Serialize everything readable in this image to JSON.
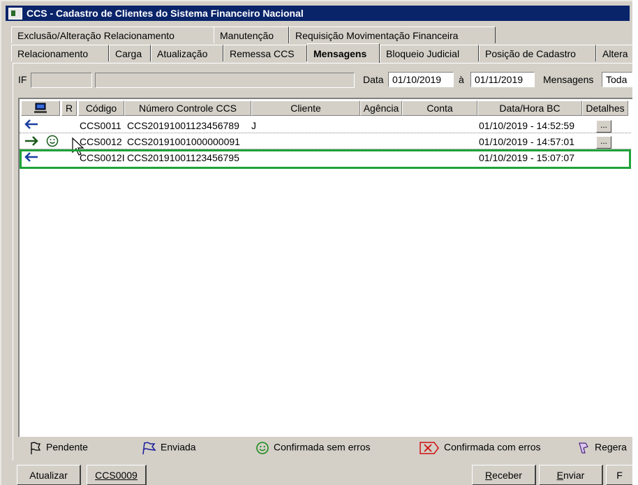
{
  "window": {
    "title": "CCS - Cadastro de Clientes do Sistema Financeiro Nacional"
  },
  "tabs_row1": [
    {
      "label": "Exclusão/Alteração Relacionamento"
    },
    {
      "label": "Manutenção"
    },
    {
      "label": "Requisição Movimentação Financeira"
    }
  ],
  "tabs_row2": [
    {
      "label": "Relacionamento"
    },
    {
      "label": "Carga"
    },
    {
      "label": "Atualização"
    },
    {
      "label": "Remessa CCS"
    },
    {
      "label": "Mensagens",
      "active": true
    },
    {
      "label": "Bloqueio Judicial"
    },
    {
      "label": "Posição de Cadastro"
    },
    {
      "label": "Altera"
    }
  ],
  "filters": {
    "if_label": "IF",
    "if_code": "",
    "if_name": "",
    "data_label": "Data",
    "date_from": "01/10/2019",
    "a_label": "à",
    "date_to": "01/11/2019",
    "mensagens_label": "Mensagens",
    "mensagens_value": "Toda"
  },
  "grid": {
    "columns": [
      "R",
      "Código",
      "Número Controle CCS",
      "Cliente",
      "Agência",
      "Conta",
      "Data/Hora BC",
      "Detalhes"
    ],
    "rows": [
      {
        "direction": "in",
        "status": "",
        "codigo": "CCS0011",
        "numero": "CCS20191001123456789",
        "cliente": "J",
        "agencia": "",
        "conta": "",
        "datahora": "01/10/2019 - 14:52:59",
        "details": "..."
      },
      {
        "direction": "out",
        "status": "confirmed",
        "codigo": "CCS0012",
        "numero": "CCS20191001000000091",
        "cliente": "",
        "agencia": "",
        "conta": "",
        "datahora": "01/10/2019 - 14:57:01",
        "details": "..."
      },
      {
        "direction": "in",
        "status": "",
        "codigo": "CCS0012I",
        "numero": "CCS20191001123456795",
        "cliente": "",
        "agencia": "",
        "conta": "",
        "datahora": "01/10/2019 - 15:07:07",
        "details": ""
      }
    ]
  },
  "legend": [
    {
      "icon": "flag-outline-icon",
      "label": "Pendente"
    },
    {
      "icon": "flag-blue-icon",
      "label": "Enviada"
    },
    {
      "icon": "smiley-icon",
      "label": "Confirmada sem erros"
    },
    {
      "icon": "red-x-icon",
      "label": "Confirmada com erros"
    },
    {
      "icon": "regera-icon",
      "label": "Regera"
    }
  ],
  "buttons": {
    "atualizar": "Atualizar",
    "ccs0009": "CCS0009",
    "receber_first": "R",
    "receber_rest": "eceber",
    "enviar_first": "E",
    "enviar_rest": "nviar",
    "last": "F"
  },
  "colors": {
    "highlight": "#1fa23a",
    "titlebar": "#0a246a",
    "arrow": "#1b3fa0"
  }
}
